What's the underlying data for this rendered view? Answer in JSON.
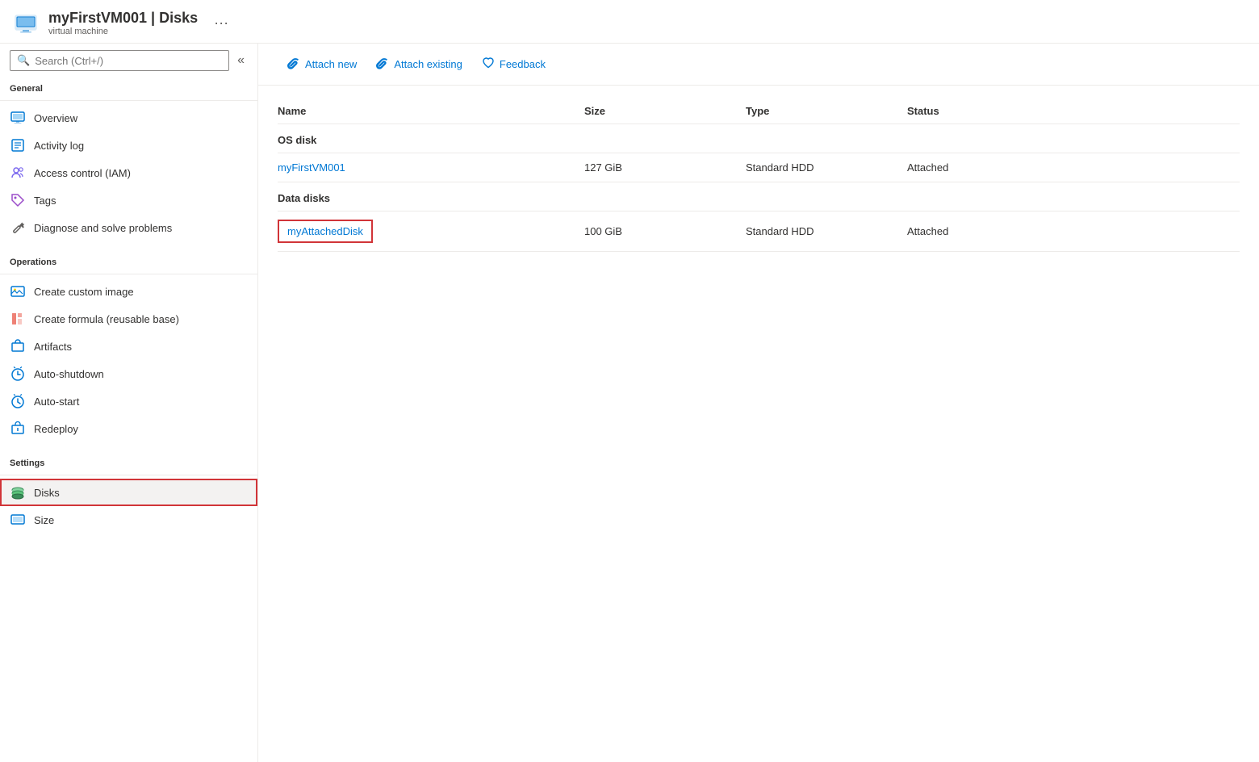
{
  "header": {
    "title": "myFirstVM001 | Disks",
    "resource_type": "virtual machine",
    "ellipsis": "···"
  },
  "sidebar": {
    "search_placeholder": "Search (Ctrl+/)",
    "collapse_icon": "«",
    "sections": [
      {
        "label": "General",
        "items": [
          {
            "id": "overview",
            "label": "Overview",
            "icon": "monitor"
          },
          {
            "id": "activity-log",
            "label": "Activity log",
            "icon": "activity"
          },
          {
            "id": "access-control",
            "label": "Access control (IAM)",
            "icon": "people"
          },
          {
            "id": "tags",
            "label": "Tags",
            "icon": "tag"
          },
          {
            "id": "diagnose",
            "label": "Diagnose and solve problems",
            "icon": "wrench"
          }
        ]
      },
      {
        "label": "Operations",
        "items": [
          {
            "id": "create-image",
            "label": "Create custom image",
            "icon": "image"
          },
          {
            "id": "create-formula",
            "label": "Create formula (reusable base)",
            "icon": "formula"
          },
          {
            "id": "artifacts",
            "label": "Artifacts",
            "icon": "artifacts"
          },
          {
            "id": "auto-shutdown",
            "label": "Auto-shutdown",
            "icon": "clock"
          },
          {
            "id": "auto-start",
            "label": "Auto-start",
            "icon": "clock2"
          },
          {
            "id": "redeploy",
            "label": "Redeploy",
            "icon": "redeploy"
          }
        ]
      },
      {
        "label": "Settings",
        "items": [
          {
            "id": "disks",
            "label": "Disks",
            "icon": "disk",
            "active": true
          },
          {
            "id": "size",
            "label": "Size",
            "icon": "monitor2"
          }
        ]
      }
    ]
  },
  "toolbar": {
    "buttons": [
      {
        "id": "attach-new",
        "label": "Attach new",
        "icon": "paperclip"
      },
      {
        "id": "attach-existing",
        "label": "Attach existing",
        "icon": "paperclip"
      },
      {
        "id": "feedback",
        "label": "Feedback",
        "icon": "heart"
      }
    ]
  },
  "table": {
    "columns": [
      "Name",
      "Size",
      "Type",
      "Status"
    ],
    "sections": [
      {
        "title": "OS disk",
        "rows": [
          {
            "name": "myFirstVM001",
            "size": "127 GiB",
            "type": "Standard HDD",
            "status": "Attached",
            "highlighted": false
          }
        ]
      },
      {
        "title": "Data disks",
        "rows": [
          {
            "name": "myAttachedDisk",
            "size": "100 GiB",
            "type": "Standard HDD",
            "status": "Attached",
            "highlighted": true
          }
        ]
      }
    ]
  }
}
